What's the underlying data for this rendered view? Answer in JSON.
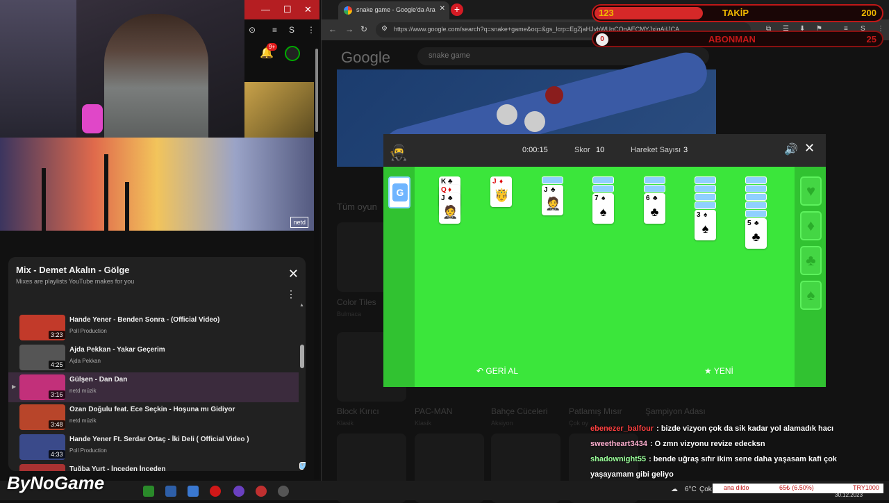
{
  "youtube": {
    "notif_count": "9+",
    "mix": {
      "title": "Mix - Demet Akalın - Gölge",
      "subtitle": "Mixes are playlists YouTube makes for you",
      "items": [
        {
          "title": "Hande Yener - Benden Sonra - (Official Video)",
          "artist": "Poll Production",
          "duration": "3:23",
          "color": "#c23a2a"
        },
        {
          "title": "Ajda Pekkan - Yakar Geçerim",
          "artist": "Ajda Pekkan",
          "duration": "4:25",
          "color": "#555555"
        },
        {
          "title": "Gülşen - Dan Dan",
          "artist": "netd müzik",
          "duration": "3:16",
          "color": "#c2307a"
        },
        {
          "title": "Ozan Doğulu feat. Ece Seçkin - Hoşuna mı Gidiyor",
          "artist": "netd müzik",
          "duration": "3:48",
          "color": "#b8452a"
        },
        {
          "title": "Hande Yener Ft. Serdar Ortaç - İki Deli ( Official Video )",
          "artist": "Poll Production",
          "duration": "4:33",
          "color": "#3a4a8a"
        },
        {
          "title": "Tuğba Yurt - İnceden İnceden",
          "artist": "",
          "duration": "",
          "color": "#a83232"
        }
      ]
    },
    "video_logo": "netd"
  },
  "browser": {
    "tab_title": "snake game - Google'da Ara",
    "url": "https://www.google.com/search?q=snake+game&oq=&gs_lcrp=EgZjaHJvbWUqCQgAECMYJxjqAjIJCA...",
    "search_query": "snake game",
    "google_logo": "Google",
    "section_title": "Tüm oyun",
    "games": [
      {
        "name": "Color Tiles",
        "genre": "Bulmaca"
      },
      {
        "name": "Block Kırıcı",
        "genre": "Klasik"
      },
      {
        "name": "PAC-MAN",
        "genre": "Klasik"
      },
      {
        "name": "Bahçe Cüceleri",
        "genre": "Aksiyon"
      },
      {
        "name": "Patlamış Mısır",
        "genre": "Çok oy"
      },
      {
        "name": "Şampiyon Adası",
        "genre": ""
      }
    ]
  },
  "solitaire": {
    "time": "0:00:15",
    "score_label": "Skor",
    "score": "10",
    "moves_label": "Hareket Sayısı",
    "moves": "3",
    "undo_label": "GERİ AL",
    "new_label": "YENİ",
    "colors": {
      "felt": "#3be63b",
      "side": "#31c231"
    }
  },
  "overlay": {
    "follow_left": "123",
    "follow_label": "TAKİP",
    "follow_right": "200",
    "follow_progress": 0.615,
    "sub_left": "0",
    "sub_label": "ABONMAN",
    "sub_right": "25"
  },
  "chat": [
    {
      "user": "ebenezer_balfour",
      "text": ": bizde vizyon çok da sik kadar yol alamadık hacı",
      "color": "#ff4040"
    },
    {
      "user": "sweetheart3434",
      "text": ": O zmn vizyonu revize edecksn",
      "color": "#ffb0d0"
    },
    {
      "user": "shadownight55",
      "text": ": bende uğraş sıfır ikim sene daha yaşasam kafi çok yaşayamam gibi geliyo",
      "color": "#9aff9a"
    }
  ],
  "taskbar": {
    "brand": "ByNoGame",
    "weather": "6°C",
    "weather_text": "Çok",
    "ticker1": "ana dildo",
    "ticker2": "65₺ (6.50%)",
    "ticker3": "TRY1000",
    "date": "30.12.2023"
  }
}
